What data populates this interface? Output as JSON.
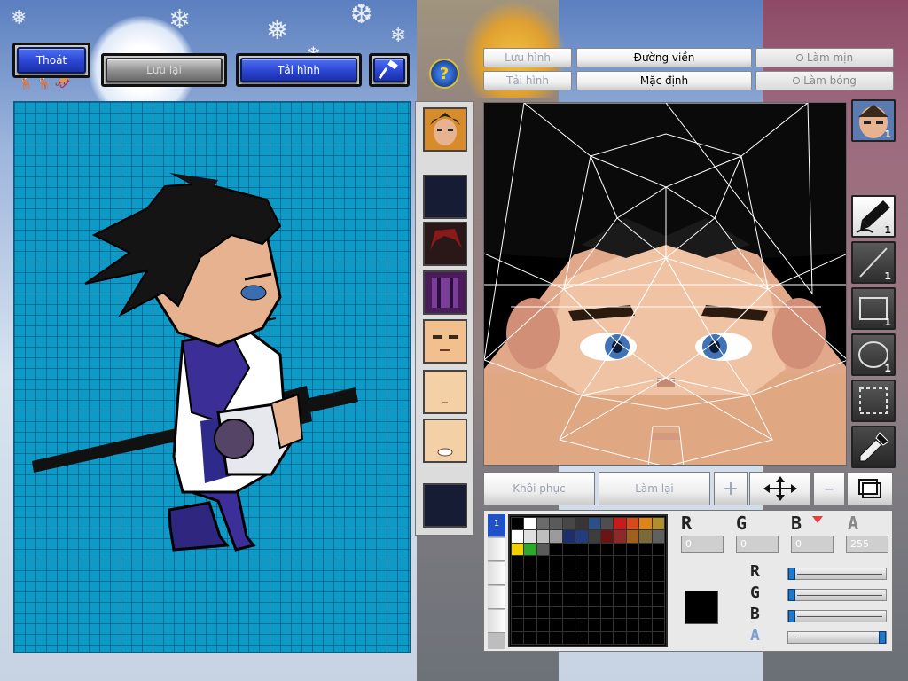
{
  "toolbar_left": {
    "exit_label": "Thoát",
    "save_label": "Lưu lại",
    "load_label": "Tải hình"
  },
  "toolbar_right": {
    "save_image_label": "Lưu hình",
    "load_image_label": "Tải hình",
    "outline_label": "Đường viền",
    "default_label": "Mặc định",
    "smooth_label": "Làm mịn",
    "shine_label": "Làm bóng"
  },
  "bottom_bar": {
    "restore_label": "Khôi phục",
    "redo_label": "Làm lại"
  },
  "tools": [
    {
      "name": "face-thumb",
      "count": "1"
    },
    {
      "name": "pen",
      "count": "1"
    },
    {
      "name": "line",
      "count": "1"
    },
    {
      "name": "rectangle",
      "count": "1"
    },
    {
      "name": "ellipse",
      "count": "1"
    },
    {
      "name": "select",
      "count": ""
    },
    {
      "name": "eyedropper",
      "count": ""
    }
  ],
  "palette": {
    "tab_label": "1",
    "colors": [
      "#000000",
      "#ffffff",
      "#6b6b6b",
      "#5a5a5a",
      "#474747",
      "#363636",
      "#2b4f86",
      "#4e4e4e",
      "#c81c1c",
      "#d84a1a",
      "#e0841a",
      "#b0902a",
      "#ffffff",
      "#e0e0e0",
      "#bebebe",
      "#9b9b9b",
      "#1c2f6a",
      "#233c7c",
      "#3d3d3d",
      "#6a1414",
      "#8c2a2a",
      "#a06020",
      "#7a6a3a",
      "#606060",
      "#f0d000",
      "#2ca82c",
      "#5a5a5a"
    ]
  },
  "color_channels": {
    "r_label": "R",
    "g_label": "G",
    "b_label": "B",
    "a_label": "A",
    "r_value": "0",
    "g_value": "0",
    "b_value": "0",
    "a_value": "255"
  },
  "sliders": {
    "r": 0,
    "g": 0,
    "b": 0,
    "a": 1
  },
  "current_color": "#000000",
  "colors": {
    "canvas_bg": "#0d9ac6",
    "accent_blue": "#2d48d6",
    "skin": "#e7b28f"
  }
}
